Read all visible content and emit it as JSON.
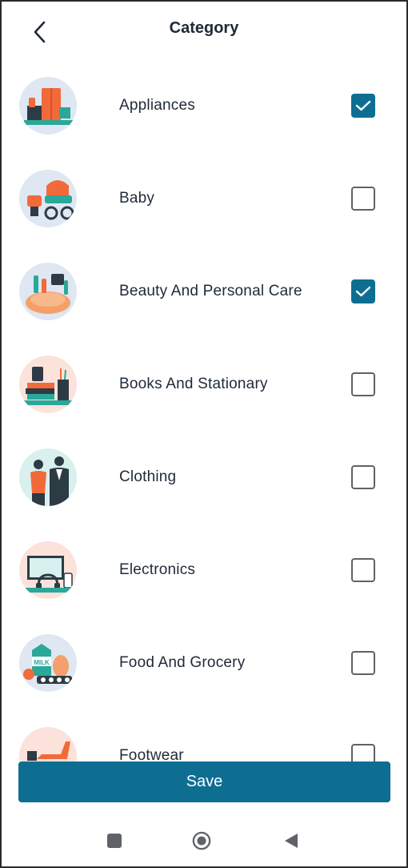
{
  "header": {
    "title": "Category",
    "back_icon": "chevron-left-icon"
  },
  "categories": [
    {
      "label": "Appliances",
      "checked": true,
      "icon": "appliances-illustration",
      "bg": "#dfe7f2"
    },
    {
      "label": "Baby",
      "checked": false,
      "icon": "baby-illustration",
      "bg": "#dfe7f2"
    },
    {
      "label": "Beauty And Personal Care",
      "checked": true,
      "icon": "beauty-illustration",
      "bg": "#dfe7f2"
    },
    {
      "label": "Books And Stationary",
      "checked": false,
      "icon": "books-illustration",
      "bg": "#fbe3dc"
    },
    {
      "label": "Clothing",
      "checked": false,
      "icon": "clothing-illustration",
      "bg": "#d8f0ee"
    },
    {
      "label": "Electronics",
      "checked": false,
      "icon": "electronics-illustration",
      "bg": "#fbe3dc"
    },
    {
      "label": "Food And Grocery",
      "checked": false,
      "icon": "grocery-illustration",
      "bg": "#dfe7f2"
    },
    {
      "label": "Footwear",
      "checked": false,
      "icon": "footwear-illustration",
      "bg": "#fbe3dc"
    }
  ],
  "save_label": "Save",
  "colors": {
    "accent": "#0e6e92",
    "text": "#1f2a37",
    "checkbox_border": "#5f6368"
  },
  "navbar": {
    "recents_icon": "square-icon",
    "home_icon": "circle-home-icon",
    "back_icon": "triangle-back-icon"
  }
}
